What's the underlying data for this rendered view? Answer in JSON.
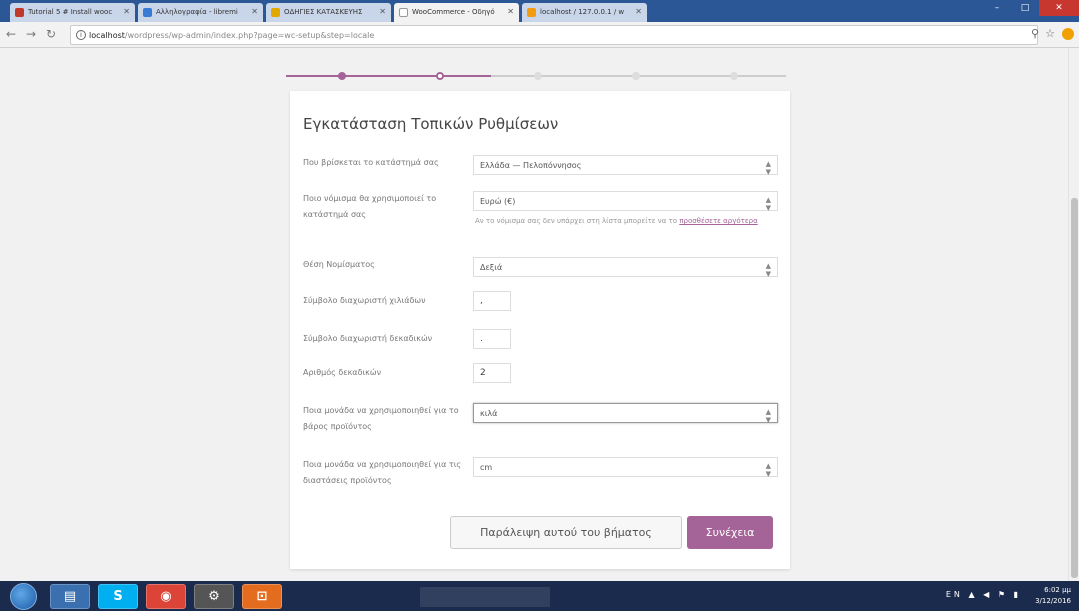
{
  "browser": {
    "tabs": [
      {
        "label": "Tutorial 5 # Install wooc",
        "color": "#c0392b",
        "active": false
      },
      {
        "label": "Αλληλογραφία - libremi",
        "color": "#3a7bd5",
        "active": false
      },
      {
        "label": "ΟΔΗΓΙΕΣ ΚΑΤΑΣΚΕΥΗΣ",
        "color": "#e0a800",
        "active": false
      },
      {
        "label": "WooCommerce - Οδηγό",
        "color": "#ffffff",
        "active": true
      },
      {
        "label": "localhost / 127.0.0.1 / w",
        "color": "#f39c12",
        "active": false
      }
    ],
    "url_host": "localhost",
    "url_path": "/wordpress/wp-admin/index.php?page=wc-setup&step=locale",
    "window_buttons": {
      "minimize": "–",
      "maximize": "□",
      "close": "✕"
    }
  },
  "wizard": {
    "title": "Εγκατάσταση Τοπικών Ρυθμίσεων",
    "fields": {
      "location": {
        "label": "Που βρίσκεται το κατάστημά σας",
        "value": "Ελλάδα — Πελοπόννησος"
      },
      "currency": {
        "label": "Ποιο νόμισμα θα χρησιμοποιεί το κατάστημά σας",
        "value": "Ευρώ (€)",
        "note": "Αν το νόμισμα σας δεν υπάρχει στη λίστα μπορείτε να το ",
        "note_link": "προσθέσετε αργότερα"
      },
      "currency_pos": {
        "label": "Θέση Νομίσματος",
        "value": "Δεξιά"
      },
      "thousand_sep": {
        "label": "Σύμβολο διαχωριστή χιλιάδων",
        "value": ","
      },
      "decimal_sep": {
        "label": "Σύμβολο διαχωριστή δεκαδικών",
        "value": "."
      },
      "num_decimals": {
        "label": "Αριθμός δεκαδικών",
        "value": "2"
      },
      "weight_unit": {
        "label": "Ποια μονάδα να χρησιμοποιηθεί για το βάρος προϊόντος",
        "value": "κιλά"
      },
      "dimension_unit": {
        "label": "Ποια μονάδα να χρησιμοποιηθεί για τις διαστάσεις προϊόντος",
        "value": "cm"
      }
    },
    "skip_label": "Παράλειψη αυτού του βήματος",
    "next_label": "Συνέχεια",
    "accent": "#a46497"
  },
  "taskbar": {
    "apps": [
      "S",
      "◉",
      "⚙",
      "⊡"
    ],
    "tray_lang": "EN",
    "time": "6:02 μμ",
    "date": "3/12/2016"
  }
}
